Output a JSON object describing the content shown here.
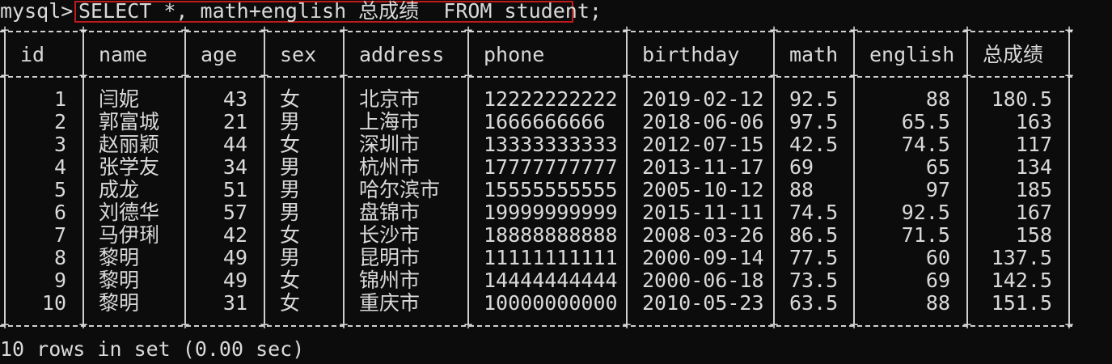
{
  "prompt": "mysql>",
  "query": "SELECT *, math+english 总成绩  FROM student;",
  "columns": [
    {
      "label": "id"
    },
    {
      "label": "name"
    },
    {
      "label": "age"
    },
    {
      "label": "sex"
    },
    {
      "label": "address"
    },
    {
      "label": "phone"
    },
    {
      "label": "birthday"
    },
    {
      "label": "math"
    },
    {
      "label": "english"
    },
    {
      "label": "总成绩"
    }
  ],
  "rows": [
    [
      "1",
      "闫妮",
      "43",
      "女",
      "北京市",
      "12222222222",
      "2019-02-12",
      "92.5",
      "88",
      "180.5"
    ],
    [
      "2",
      "郭富城",
      "21",
      "男",
      "上海市",
      "1666666666",
      "2018-06-06",
      "97.5",
      "65.5",
      "163"
    ],
    [
      "3",
      "赵丽颖",
      "44",
      "女",
      "深圳市",
      "13333333333",
      "2012-07-15",
      "42.5",
      "74.5",
      "117"
    ],
    [
      "4",
      "张学友",
      "34",
      "男",
      "杭州市",
      "17777777777",
      "2013-11-17",
      "69",
      "65",
      "134"
    ],
    [
      "5",
      "成龙",
      "51",
      "男",
      "哈尔滨市",
      "15555555555",
      "2005-10-12",
      "88",
      "97",
      "185"
    ],
    [
      "6",
      "刘德华",
      "57",
      "男",
      "盘锦市",
      "19999999999",
      "2015-11-11",
      "74.5",
      "92.5",
      "167"
    ],
    [
      "7",
      "马伊琍",
      "42",
      "女",
      "长沙市",
      "18888888888",
      "2008-03-26",
      "86.5",
      "71.5",
      "158"
    ],
    [
      "8",
      "黎明",
      "49",
      "男",
      "昆明市",
      "11111111111",
      "2000-09-14",
      "77.5",
      "60",
      "137.5"
    ],
    [
      "9",
      "黎明",
      "49",
      "女",
      "锦州市",
      "14444444444",
      "2000-06-18",
      "73.5",
      "69",
      "142.5"
    ],
    [
      "10",
      "黎明",
      "31",
      "女",
      "重庆市",
      "10000000000",
      "2010-05-23",
      "63.5",
      "88",
      "151.5"
    ]
  ],
  "footer": "10 rows in set (0.00 sec)",
  "colors": {
    "background": "#0c0c0c",
    "text": "#d9d9d9",
    "highlight_border": "#c01a1a"
  }
}
